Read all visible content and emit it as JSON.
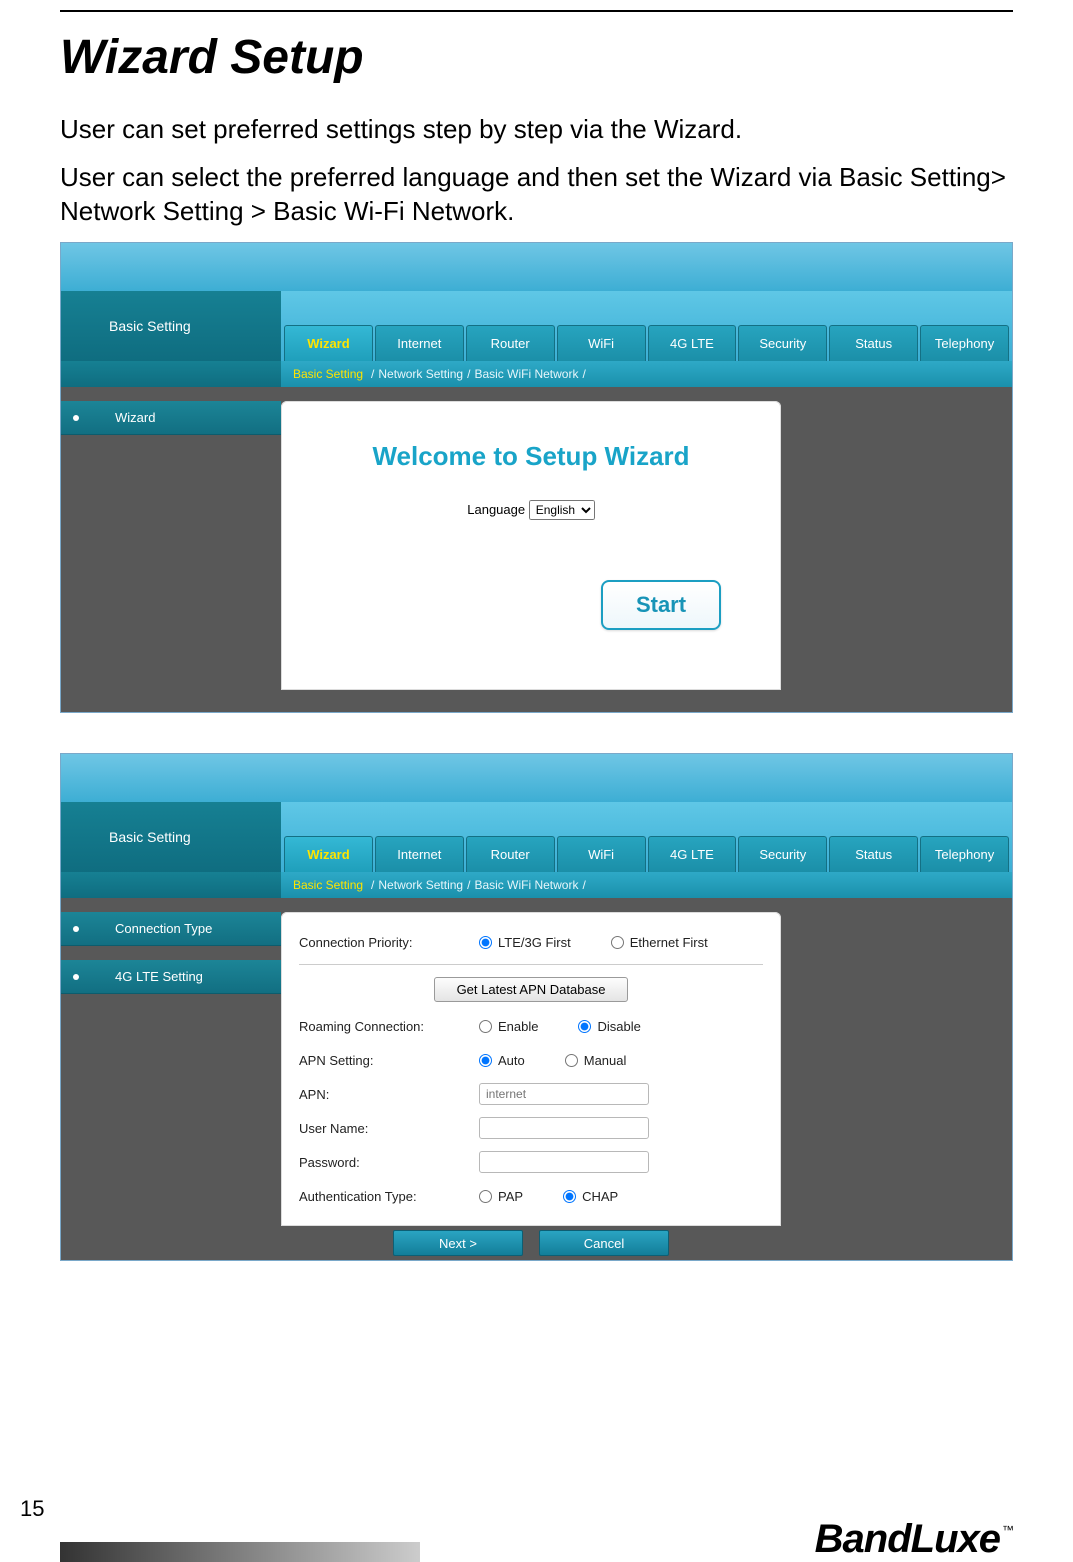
{
  "page": {
    "title": "Wizard Setup",
    "p1": "User can set preferred settings step by step via the Wizard.",
    "p2": "User can select the preferred language and then set the Wizard via Basic Setting> Network Setting > Basic Wi-Fi Network.",
    "number": "15",
    "brand": "BandLuxe",
    "tm": "™"
  },
  "tabs": [
    "Wizard",
    "Internet",
    "Router",
    "WiFi",
    "4G LTE",
    "Security",
    "Status",
    "Telephony"
  ],
  "sidebar": {
    "basic": "Basic Setting"
  },
  "breadcrumb": {
    "a": "Basic Setting",
    "b": "Network Setting",
    "c": "Basic WiFi Network",
    "sep": "/"
  },
  "shot1": {
    "sidebar_item": "Wizard",
    "welcome": "Welcome to Setup Wizard",
    "lang_label": "Language",
    "lang_value": "English",
    "start": "Start"
  },
  "shot2": {
    "sidebar_items": [
      "Connection Type",
      "4G LTE Setting"
    ],
    "labels": {
      "conn_priority": "Connection Priority:",
      "lte_first": "LTE/3G First",
      "eth_first": "Ethernet First",
      "apn_db": "Get Latest APN Database",
      "roaming": "Roaming Connection:",
      "enable": "Enable",
      "disable": "Disable",
      "apn_setting": "APN Setting:",
      "auto": "Auto",
      "manual": "Manual",
      "apn": "APN:",
      "apn_placeholder": "internet",
      "username": "User Name:",
      "password": "Password:",
      "auth": "Authentication Type:",
      "pap": "PAP",
      "chap": "CHAP"
    },
    "footer": {
      "next": "Next >",
      "cancel": "Cancel"
    }
  }
}
